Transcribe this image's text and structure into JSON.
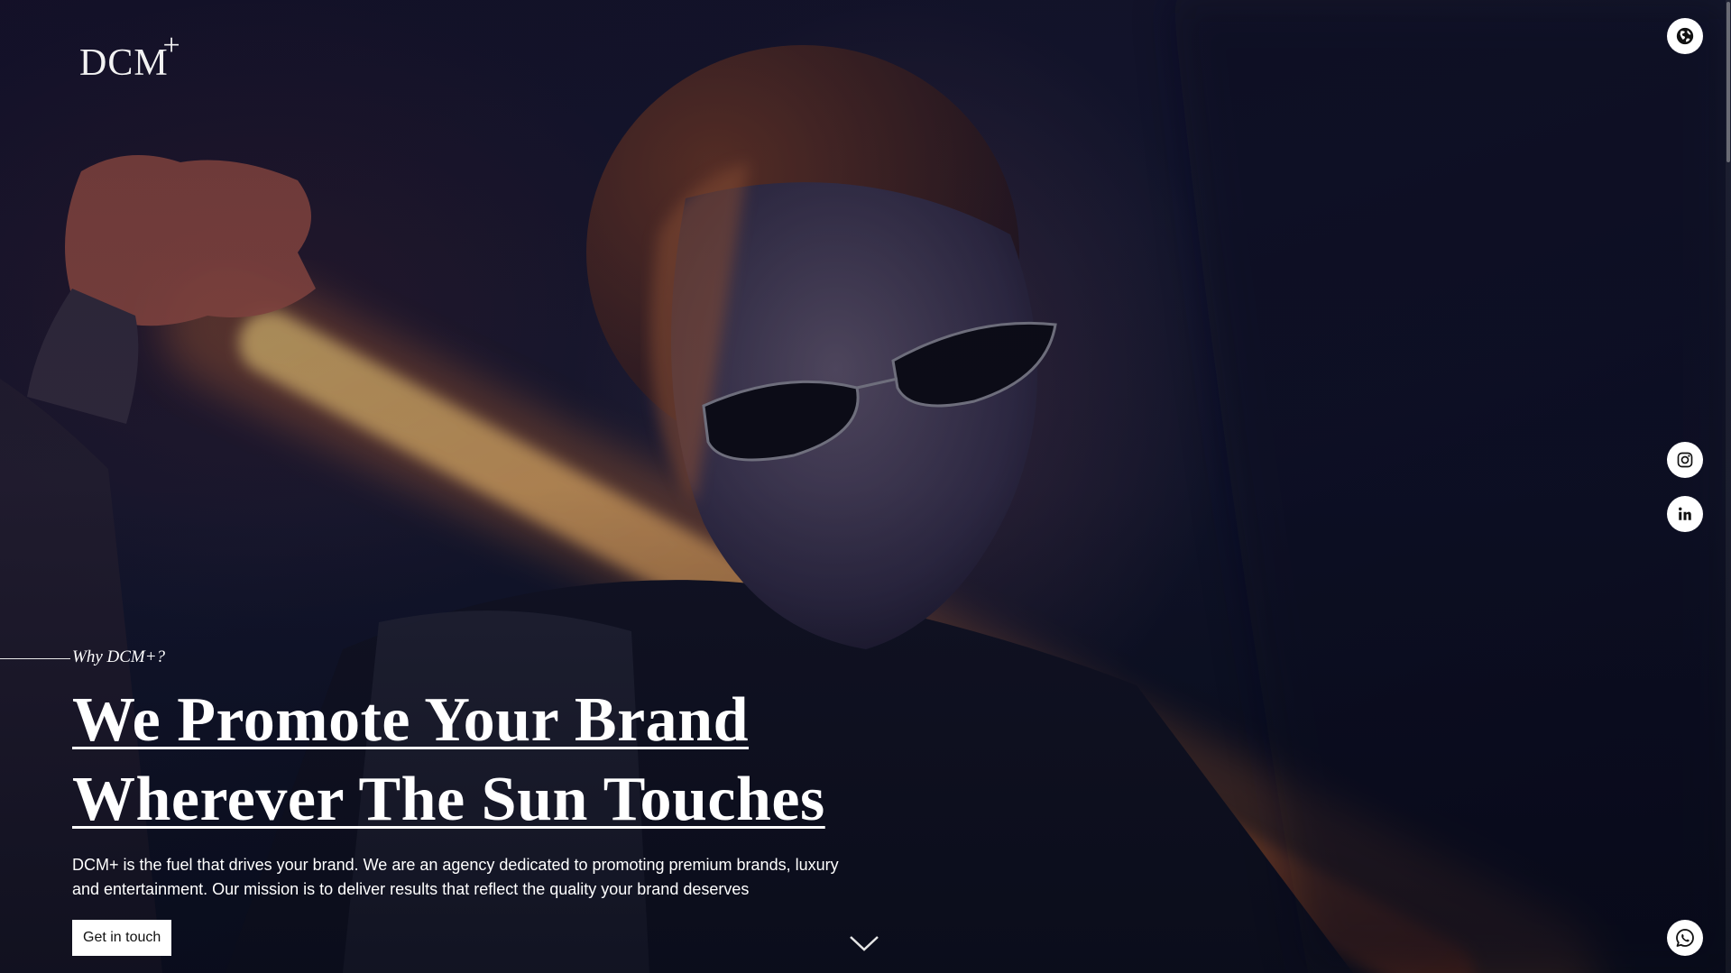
{
  "brand": {
    "logo_text": "DCM",
    "logo_mark": "+"
  },
  "hero": {
    "kicker": "Why DCM+?",
    "headline_line1": "We Promote Your Brand",
    "headline_line2": "Wherever The Sun Touches",
    "description": "DCM+ is the fuel that drives your brand. We are an agency dedicated to promoting premium brands, luxury and entertainment. Our mission is to deliver results that reflect the quality your brand deserves",
    "cta_label": "Get in touch"
  },
  "icons": {
    "language": "globe-icon",
    "instagram": "instagram-icon",
    "linkedin": "linkedin-icon",
    "whatsapp": "whatsapp-icon",
    "scroll": "chevron-down-icon"
  },
  "colors": {
    "background": "#0a0d1e",
    "text": "#ffffff",
    "button_bg": "#ffffff",
    "glow": "#f5a35a"
  }
}
